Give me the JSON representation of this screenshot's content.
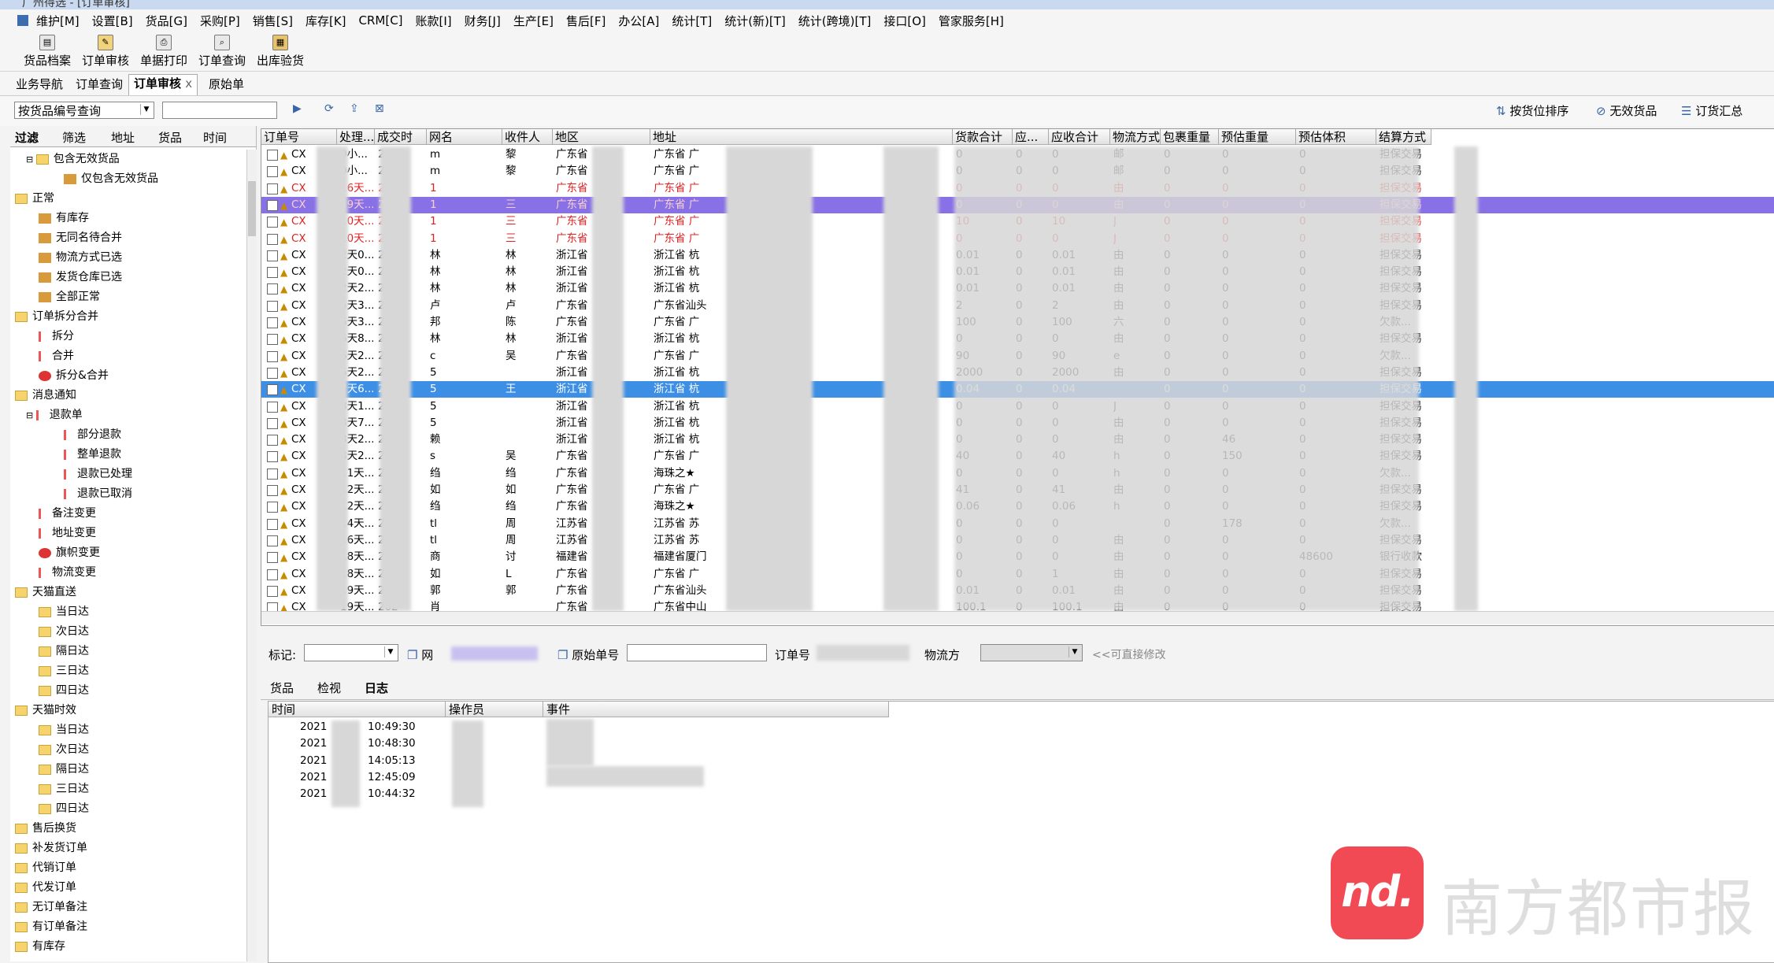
{
  "window": {
    "title": "广州得选 - [订单审核]"
  },
  "menu": [
    "维护[M]",
    "设置[B]",
    "货品[G]",
    "采购[P]",
    "销售[S]",
    "库存[K]",
    "CRM[C]",
    "账款[I]",
    "财务[J]",
    "生产[E]",
    "售后[F]",
    "办公[A]",
    "统计[T]",
    "统计(新)[T]",
    "统计(跨境)[T]",
    "接口[O]",
    "管家服务[H]"
  ],
  "toolbar": [
    "货品档案",
    "订单审核",
    "单据打印",
    "订单查询",
    "出库验货"
  ],
  "tabs": [
    "业务导航",
    "订单查询",
    "订单审核",
    "原始单"
  ],
  "tab_close": "x",
  "filter": {
    "select_value": "按货品编号查询",
    "search_value": "",
    "right_buttons": [
      "按货位排序",
      "无效货品",
      "订货汇总"
    ]
  },
  "left_tabs": [
    "过滤",
    "筛选",
    "地址",
    "货品",
    "时间"
  ],
  "tree": [
    {
      "label": "包含无效货品",
      "depth": 1,
      "icon": "folder"
    },
    {
      "label": "仅包含无效货品",
      "depth": 3,
      "icon": "pic"
    },
    {
      "label": "正常",
      "depth": 0,
      "icon": "folder"
    },
    {
      "label": "有库存",
      "depth": 2,
      "icon": "pic"
    },
    {
      "label": "无同名待合并",
      "depth": 2,
      "icon": "pic"
    },
    {
      "label": "物流方式已选",
      "depth": 2,
      "icon": "pic"
    },
    {
      "label": "发货仓库已选",
      "depth": 2,
      "icon": "pic"
    },
    {
      "label": "全部正常",
      "depth": 2,
      "icon": "pic"
    },
    {
      "label": "订单拆分合并",
      "depth": 0,
      "icon": "folder"
    },
    {
      "label": "拆分",
      "depth": 2,
      "icon": "text"
    },
    {
      "label": "合并",
      "depth": 2,
      "icon": "text"
    },
    {
      "label": "拆分&合并",
      "depth": 2,
      "icon": "red"
    },
    {
      "label": "消息通知",
      "depth": 0,
      "icon": "folder"
    },
    {
      "label": "退款单",
      "depth": 1,
      "icon": "text"
    },
    {
      "label": "部分退款",
      "depth": 3,
      "icon": "text"
    },
    {
      "label": "整单退款",
      "depth": 3,
      "icon": "text"
    },
    {
      "label": "退款已处理",
      "depth": 3,
      "icon": "text"
    },
    {
      "label": "退款已取消",
      "depth": 3,
      "icon": "text"
    },
    {
      "label": "备注变更",
      "depth": 2,
      "icon": "text"
    },
    {
      "label": "地址变更",
      "depth": 2,
      "icon": "text"
    },
    {
      "label": "旗帜变更",
      "depth": 2,
      "icon": "red"
    },
    {
      "label": "物流变更",
      "depth": 2,
      "icon": "text"
    },
    {
      "label": "天猫直送",
      "depth": 0,
      "icon": "folder"
    },
    {
      "label": "当日达",
      "depth": 2,
      "icon": "folder"
    },
    {
      "label": "次日达",
      "depth": 2,
      "icon": "folder"
    },
    {
      "label": "隔日达",
      "depth": 2,
      "icon": "folder"
    },
    {
      "label": "三日达",
      "depth": 2,
      "icon": "folder"
    },
    {
      "label": "四日达",
      "depth": 2,
      "icon": "folder"
    },
    {
      "label": "天猫时效",
      "depth": 0,
      "icon": "folder"
    },
    {
      "label": "当日达",
      "depth": 2,
      "icon": "folder"
    },
    {
      "label": "次日达",
      "depth": 2,
      "icon": "folder"
    },
    {
      "label": "隔日达",
      "depth": 2,
      "icon": "folder"
    },
    {
      "label": "三日达",
      "depth": 2,
      "icon": "folder"
    },
    {
      "label": "四日达",
      "depth": 2,
      "icon": "folder"
    },
    {
      "label": "售后换货",
      "depth": 0,
      "icon": "folder"
    },
    {
      "label": "补发货订单",
      "depth": 0,
      "icon": "folder"
    },
    {
      "label": "代销订单",
      "depth": 0,
      "icon": "folder"
    },
    {
      "label": "代发订单",
      "depth": 0,
      "icon": "folder"
    },
    {
      "label": "无订单备注",
      "depth": 0,
      "icon": "folder"
    },
    {
      "label": "有订单备注",
      "depth": 0,
      "icon": "folder"
    },
    {
      "label": "有库存",
      "depth": 0,
      "icon": "folder"
    }
  ],
  "grid": {
    "columns": [
      "订单号",
      "处理...",
      "成交时",
      "网名",
      "收件人",
      "地区",
      "地址",
      "货款合计",
      "应...",
      "应收合计",
      "物流方式",
      "包裹重量",
      "预估重量",
      "预估体积",
      "结算方式"
    ],
    "rows": [
      {
        "id": "CX",
        "proc": "0小...",
        "date": "2021",
        "net": "m",
        "recv": "黎",
        "region": "广东省",
        "addr": "广东省 广",
        "amt": "0",
        "due": "0",
        "recv_total": "0",
        "ship": "邮",
        "wt": "0",
        "est": "0",
        "vol": "0",
        "pay": "担保交易",
        "style": "normal"
      },
      {
        "id": "CX",
        "proc": "0小...",
        "date": "2021",
        "net": "m",
        "recv": "黎",
        "region": "广东省",
        "addr": "广东省 广",
        "amt": "0",
        "due": "0",
        "recv_total": "0",
        "ship": "邮",
        "wt": "0",
        "est": "0",
        "vol": "0",
        "pay": "担保交易",
        "style": "normal"
      },
      {
        "id": "CX",
        "proc": "16天...",
        "date": "202",
        "net": "1",
        "recv": "",
        "region": "广东省",
        "addr": "广东省 广",
        "amt": "0",
        "due": "0",
        "recv_total": "0",
        "ship": "由",
        "wt": "0",
        "est": "0",
        "vol": "0",
        "pay": "担保交易",
        "style": "red"
      },
      {
        "id": "CX",
        "proc": "19天...",
        "date": "202",
        "net": "1",
        "recv": "三",
        "region": "广东省",
        "addr": "广东省 广",
        "amt": "0",
        "due": "0",
        "recv_total": "0",
        "ship": "由",
        "wt": "0",
        "est": "0",
        "vol": "0",
        "pay": "担保交易",
        "style": "purple"
      },
      {
        "id": "CX",
        "proc": "10天...",
        "date": "202",
        "net": "1",
        "recv": "三",
        "region": "广东省",
        "addr": "广东省 广",
        "amt": "10",
        "due": "0",
        "recv_total": "10",
        "ship": "J",
        "wt": "0",
        "est": "0",
        "vol": "0",
        "pay": "担保交易",
        "style": "red"
      },
      {
        "id": "CX",
        "proc": "10天...",
        "date": "202",
        "net": "1",
        "recv": "三",
        "region": "广东省",
        "addr": "广东省 广",
        "amt": "0",
        "due": "0",
        "recv_total": "0",
        "ship": "J",
        "wt": "0",
        "est": "0",
        "vol": "0",
        "pay": "担保交易",
        "style": "red"
      },
      {
        "id": "CX",
        "proc": "2天0...",
        "date": "2021",
        "net": "林",
        "recv": "林",
        "region": "浙江省",
        "addr": "浙江省 杭",
        "amt": "0.01",
        "due": "0",
        "recv_total": "0.01",
        "ship": "由",
        "wt": "0",
        "est": "0",
        "vol": "0",
        "pay": "担保交易",
        "style": "normal"
      },
      {
        "id": "CX",
        "proc": "2天0...",
        "date": "2021",
        "net": "林",
        "recv": "林",
        "region": "浙江省",
        "addr": "浙江省 杭",
        "amt": "0.01",
        "due": "0",
        "recv_total": "0.01",
        "ship": "由",
        "wt": "0",
        "est": "0",
        "vol": "0",
        "pay": "担保交易",
        "style": "normal"
      },
      {
        "id": "CX",
        "proc": "2天2...",
        "date": "2021",
        "net": "林",
        "recv": "林",
        "region": "浙江省",
        "addr": "浙江省 杭",
        "amt": "0.01",
        "due": "0",
        "recv_total": "0.01",
        "ship": "由",
        "wt": "0",
        "est": "0",
        "vol": "0",
        "pay": "担保交易",
        "style": "normal"
      },
      {
        "id": "CX",
        "proc": "5天3...",
        "date": "2021",
        "net": "卢",
        "recv": "卢",
        "region": "广东省",
        "addr": "广东省汕头",
        "amt": "2",
        "due": "0",
        "recv_total": "2",
        "ship": "由",
        "wt": "0",
        "est": "0",
        "vol": "0",
        "pay": "担保交易",
        "style": "normal"
      },
      {
        "id": "CX",
        "proc": "6天3...",
        "date": "202",
        "net": "邦",
        "recv": "陈",
        "region": "广东省",
        "addr": "广东省 广",
        "amt": "100",
        "due": "0",
        "recv_total": "100",
        "ship": "六",
        "wt": "0",
        "est": "0",
        "vol": "0",
        "pay": "欠款...",
        "style": "normal"
      },
      {
        "id": "CX",
        "proc": "6天8...",
        "date": "202",
        "net": "林",
        "recv": "林",
        "region": "浙江省",
        "addr": "浙江省 杭",
        "amt": "0",
        "due": "0",
        "recv_total": "0",
        "ship": "由",
        "wt": "0",
        "est": "0",
        "vol": "0",
        "pay": "担保交易",
        "style": "normal"
      },
      {
        "id": "CX",
        "proc": "6天2...",
        "date": "202",
        "net": "c",
        "recv": "吴",
        "region": "广东省",
        "addr": "广东省 广",
        "amt": "90",
        "due": "0",
        "recv_total": "90",
        "ship": "e",
        "wt": "0",
        "est": "0",
        "vol": "0",
        "pay": "欠款...",
        "style": "normal"
      },
      {
        "id": "CX",
        "proc": "6天2...",
        "date": "202",
        "net": "5",
        "recv": "",
        "region": "浙江省",
        "addr": "浙江省 杭",
        "amt": "2000",
        "due": "0",
        "recv_total": "2000",
        "ship": "由",
        "wt": "0",
        "est": "0",
        "vol": "0",
        "pay": "担保交易",
        "style": "normal"
      },
      {
        "id": "CX",
        "proc": "7天6...",
        "date": "202",
        "net": "5",
        "recv": "王",
        "region": "浙江省",
        "addr": "浙江省 杭",
        "amt": "0.04",
        "due": "0",
        "recv_total": "0.04",
        "ship": "",
        "wt": "0",
        "est": "0",
        "vol": "0",
        "pay": "担保交易",
        "style": "blue"
      },
      {
        "id": "CX",
        "proc": "8天1...",
        "date": "202",
        "net": "5",
        "recv": "",
        "region": "浙江省",
        "addr": "浙江省 杭",
        "amt": "0",
        "due": "0",
        "recv_total": "0",
        "ship": "J",
        "wt": "0",
        "est": "0",
        "vol": "0",
        "pay": "担保交易",
        "style": "normal"
      },
      {
        "id": "CX",
        "proc": "8天7...",
        "date": "202",
        "net": "5",
        "recv": "",
        "region": "浙江省",
        "addr": "浙江省 杭",
        "amt": "0",
        "due": "0",
        "recv_total": "0",
        "ship": "由",
        "wt": "0",
        "est": "0",
        "vol": "0",
        "pay": "担保交易",
        "style": "normal"
      },
      {
        "id": "CX",
        "proc": "8天2...",
        "date": "202",
        "net": "赖",
        "recv": "",
        "region": "浙江省",
        "addr": "浙江省 杭",
        "amt": "0",
        "due": "0",
        "recv_total": "0",
        "ship": "由",
        "wt": "0",
        "est": "46",
        "vol": "0",
        "pay": "担保交易",
        "style": "normal"
      },
      {
        "id": "CX",
        "proc": "8天2...",
        "date": "202",
        "net": "s",
        "recv": "吴",
        "region": "广东省",
        "addr": "广东省 广",
        "amt": "40",
        "due": "0",
        "recv_total": "40",
        "ship": "h",
        "wt": "0",
        "est": "150",
        "vol": "0",
        "pay": "担保交易",
        "style": "normal"
      },
      {
        "id": "CX",
        "proc": "11天...",
        "date": "202",
        "net": "绉",
        "recv": "绉",
        "region": "广东省",
        "addr": "海珠之★",
        "amt": "0",
        "due": "0",
        "recv_total": "0",
        "ship": "h",
        "wt": "0",
        "est": "0",
        "vol": "0",
        "pay": "欠款...",
        "style": "normal"
      },
      {
        "id": "CX",
        "proc": "12天...",
        "date": "202",
        "net": "如",
        "recv": "如",
        "region": "广东省",
        "addr": "广东省 广",
        "amt": "41",
        "due": "0",
        "recv_total": "41",
        "ship": "由",
        "wt": "0",
        "est": "0",
        "vol": "0",
        "pay": "担保交易",
        "style": "normal"
      },
      {
        "id": "CX",
        "proc": "12天...",
        "date": "202",
        "net": "绉",
        "recv": "绉",
        "region": "广东省",
        "addr": "海珠之★",
        "amt": "0.06",
        "due": "0",
        "recv_total": "0.06",
        "ship": "h",
        "wt": "0",
        "est": "0",
        "vol": "0",
        "pay": "担保交易",
        "style": "normal"
      },
      {
        "id": "CX",
        "proc": "14天...",
        "date": "202",
        "net": "tl",
        "recv": "周",
        "region": "江苏省",
        "addr": "江苏省 苏",
        "amt": "0",
        "due": "0",
        "recv_total": "0",
        "ship": "",
        "wt": "0",
        "est": "178",
        "vol": "0",
        "pay": "欠款...",
        "style": "normal"
      },
      {
        "id": "CX",
        "proc": "16天...",
        "date": "202",
        "net": "tl",
        "recv": "周",
        "region": "江苏省",
        "addr": "江苏省 苏",
        "amt": "0",
        "due": "0",
        "recv_total": "0",
        "ship": "由",
        "wt": "0",
        "est": "0",
        "vol": "0",
        "pay": "担保交易",
        "style": "normal"
      },
      {
        "id": "CX",
        "proc": "18天...",
        "date": "202",
        "net": "商",
        "recv": "讨",
        "region": "福建省",
        "addr": "福建省厦门",
        "amt": "0",
        "due": "0",
        "recv_total": "0",
        "ship": "由",
        "wt": "0",
        "est": "0",
        "vol": "48600",
        "pay": "银行收款",
        "style": "normal"
      },
      {
        "id": "CX",
        "proc": "18天...",
        "date": "202",
        "net": "如",
        "recv": "L",
        "region": "广东省",
        "addr": "广东省 广",
        "amt": "0",
        "due": "0",
        "recv_total": "1",
        "ship": "由",
        "wt": "0",
        "est": "0",
        "vol": "0",
        "pay": "担保交易",
        "style": "normal"
      },
      {
        "id": "CX",
        "proc": "19天...",
        "date": "202",
        "net": "郭",
        "recv": "郭",
        "region": "广东省",
        "addr": "广东省汕头",
        "amt": "0.01",
        "due": "0",
        "recv_total": "0.01",
        "ship": "由",
        "wt": "0",
        "est": "0",
        "vol": "0",
        "pay": "担保交易",
        "style": "normal"
      },
      {
        "id": "CX",
        "proc": "19天...",
        "date": "202",
        "net": "肖",
        "recv": "",
        "region": "广东省",
        "addr": "广东省中山",
        "amt": "100.1",
        "due": "0",
        "recv_total": "100.1",
        "ship": "由",
        "wt": "0",
        "est": "0",
        "vol": "0",
        "pay": "担保交易",
        "style": "normal"
      }
    ]
  },
  "midbar": {
    "mark_label": "标记:",
    "net_label": "网",
    "orig_label": "原始单号",
    "order_label": "订单号",
    "logistics_label": "物流方",
    "hint": "<<可直接修改"
  },
  "bottom_tabs": [
    "货品",
    "检视",
    "日志"
  ],
  "log": {
    "columns": [
      "时间",
      "操作员",
      "事件"
    ],
    "rows": [
      {
        "date": "2021",
        "time": "10:49:30"
      },
      {
        "date": "2021",
        "time": "10:48:30"
      },
      {
        "date": "2021",
        "time": "14:05:13"
      },
      {
        "date": "2021",
        "time": "12:45:09"
      },
      {
        "date": "2021",
        "time": "10:44:32"
      }
    ]
  },
  "watermark": {
    "logo": "nd.",
    "text": "南方都市报"
  },
  "colors": {
    "selected_row": "#3d8fe6",
    "highlight_row": "#8870e6",
    "alert_text": "#e02020",
    "logo": "#f24a55"
  }
}
